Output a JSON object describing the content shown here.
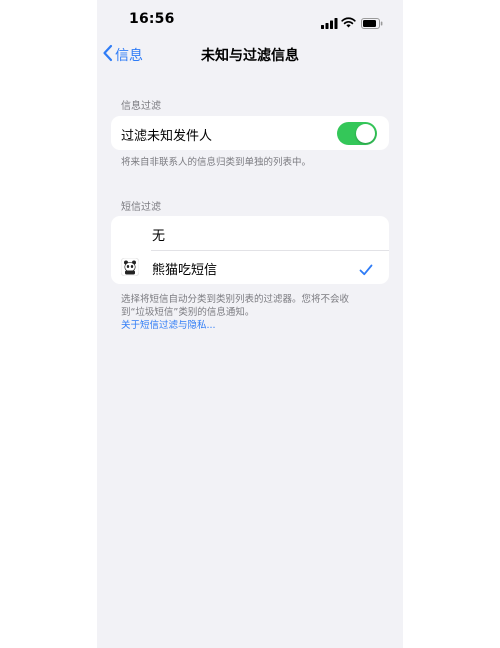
{
  "status_bar": {
    "time": "16:56"
  },
  "nav": {
    "back_label": "信息",
    "title": "未知与过滤信息"
  },
  "filter_section": {
    "header": "信息过滤",
    "toggle_label": "过滤未知发件人",
    "toggle_on": true,
    "footer": "将来自非联系人的信息归类到单独的列表中。"
  },
  "sms_section": {
    "header": "短信过滤",
    "options": [
      {
        "label": "无",
        "selected": false
      },
      {
        "label": "熊猫吃短信",
        "selected": true
      }
    ],
    "footer_line1": "选择将短信自动分类到类别列表的过滤器。您将不会收",
    "footer_line2": "到“垃圾短信”类别的信息通知。",
    "link": "关于短信过滤与隐私..."
  },
  "colors": {
    "accent": "#2f7cf6",
    "toggle_on": "#34c759",
    "background": "#f2f2f6"
  }
}
